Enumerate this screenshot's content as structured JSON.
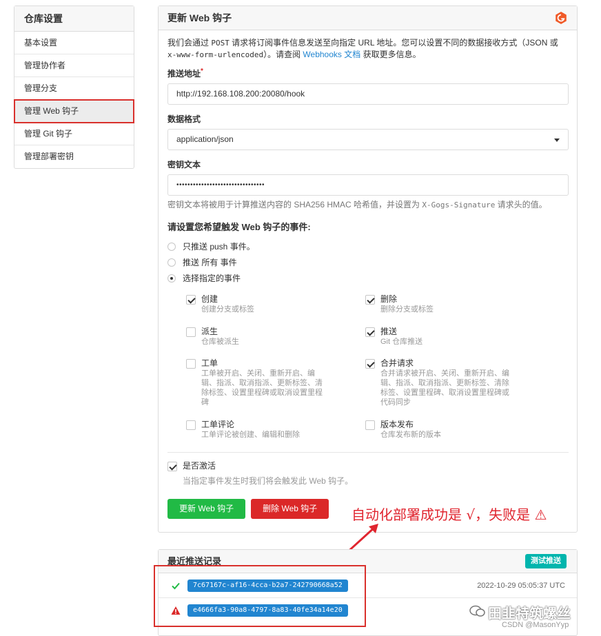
{
  "sidebar": {
    "title": "仓库设置",
    "items": [
      {
        "label": "基本设置"
      },
      {
        "label": "管理协作者"
      },
      {
        "label": "管理分支"
      },
      {
        "label": "管理 Web 钩子"
      },
      {
        "label": "管理 Git 钩子"
      },
      {
        "label": "管理部署密钥"
      }
    ]
  },
  "panel": {
    "title": "更新 Web 钩子",
    "intro_1": "我们会通过 ",
    "intro_post": "POST",
    "intro_2": " 请求将订阅事件信息发送至向指定 URL 地址。您可以设置不同的数据接收方式（JSON 或 ",
    "intro_form": "x-www-form-urlencoded",
    "intro_3": "）。请查阅 ",
    "intro_link": "Webhooks 文档",
    "intro_4": " 获取更多信息。",
    "url_label": "推送地址",
    "url_required": "*",
    "url_value": "http://192.168.108.200:20080/hook",
    "format_label": "数据格式",
    "format_value": "application/json",
    "secret_label": "密钥文本",
    "secret_value": "••••••••••••••••••••••••••••••••",
    "secret_help_1": "密钥文本将被用于计算推送内容的 SHA256 HMAC 哈希值，并设置为 ",
    "secret_help_header": "X-Gogs-Signature",
    "secret_help_2": " 请求头的值。",
    "events_title": "请设置您希望触发 Web 钩子的事件:",
    "radio_options": [
      {
        "label": "只推送 push 事件。",
        "selected": false
      },
      {
        "label": "推送 所有 事件",
        "selected": false
      },
      {
        "label": "选择指定的事件",
        "selected": true
      }
    ],
    "events": [
      {
        "title": "创建",
        "desc": "创建分支或标签",
        "checked": true
      },
      {
        "title": "删除",
        "desc": "删除分支或标签",
        "checked": true
      },
      {
        "title": "派生",
        "desc": "仓库被派生",
        "checked": false
      },
      {
        "title": "推送",
        "desc": "Git 仓库推送",
        "checked": true
      },
      {
        "title": "工单",
        "desc": "工单被开启、关闭、重新开启、编辑、指派、取消指派、更新标签、清除标签、设置里程碑或取消设置里程碑",
        "checked": false
      },
      {
        "title": "合并请求",
        "desc": "合并请求被开启、关闭、重新开启、编辑、指派、取消指派、更新标签、清除标签、设置里程碑、取消设置里程碑或代码同步",
        "checked": true
      },
      {
        "title": "工单评论",
        "desc": "工单评论被创建、编辑和删除",
        "checked": false
      },
      {
        "title": "版本发布",
        "desc": "仓库发布新的版本",
        "checked": false
      }
    ],
    "active_label": "是否激活",
    "active_checked": true,
    "active_desc": "当指定事件发生时我们将会触发此 Web 钩子。",
    "update_button": "更新 Web 钩子",
    "delete_button": "删除 Web 钩子"
  },
  "annotation": {
    "text": "自动化部署成功是 √，失败是 ⚠"
  },
  "deliveries": {
    "title": "最近推送记录",
    "test_button": "测试推送",
    "rows": [
      {
        "status": "success",
        "uuid": "7c67167c-af16-4cca-b2a7-242790668a52",
        "time": "2022-10-29 05:05:37 UTC"
      },
      {
        "status": "failure",
        "uuid": "e4666fa3-90a8-4797-8a83-40fe34a14e20",
        "time": ""
      }
    ]
  },
  "watermark": {
    "text": "田韭特筑螺丝",
    "csdn": "CSDN @MasonYyp"
  },
  "colors": {
    "accent_blue": "#2185d0",
    "green": "#21ba45",
    "red": "#db2828",
    "teal": "#00b5ad",
    "annotation_red": "#e0252f"
  }
}
